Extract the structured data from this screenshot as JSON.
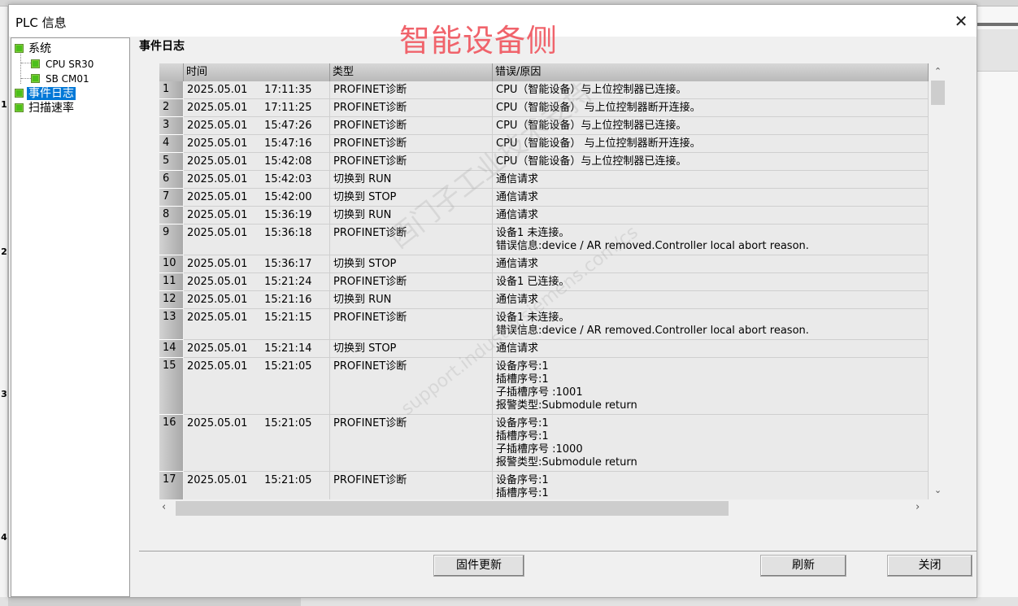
{
  "dialog": {
    "title": "PLC 信息",
    "overlay_label": "智能设备侧"
  },
  "bg": {
    "left_numbers": [
      "1",
      "2",
      "3",
      "4"
    ]
  },
  "tree": {
    "items": [
      {
        "label": "系统"
      },
      {
        "label": "CPU SR30"
      },
      {
        "label": "SB CM01"
      },
      {
        "label": "事件日志"
      },
      {
        "label": "扫描速率"
      }
    ]
  },
  "main": {
    "section_title": "事件日志",
    "columns": [
      "",
      "时间",
      "类型",
      "错误/原因"
    ],
    "rows": [
      {
        "num": "1",
        "time": "2025.05.01     17:11:35",
        "type": "PROFINET诊断",
        "reason": [
          "CPU（智能设备）与上位控制器已连接。"
        ]
      },
      {
        "num": "2",
        "time": "2025.05.01     17:11:25",
        "type": "PROFINET诊断",
        "reason": [
          "CPU（智能设备） 与上位控制器断开连接。"
        ]
      },
      {
        "num": "3",
        "time": "2025.05.01     15:47:26",
        "type": "PROFINET诊断",
        "reason": [
          "CPU（智能设备）与上位控制器已连接。"
        ]
      },
      {
        "num": "4",
        "time": "2025.05.01     15:47:16",
        "type": "PROFINET诊断",
        "reason": [
          "CPU（智能设备） 与上位控制器断开连接。"
        ]
      },
      {
        "num": "5",
        "time": "2025.05.01     15:42:08",
        "type": "PROFINET诊断",
        "reason": [
          "CPU（智能设备）与上位控制器已连接。"
        ]
      },
      {
        "num": "6",
        "time": "2025.05.01     15:42:03",
        "type": "切换到 RUN",
        "reason": [
          "通信请求"
        ]
      },
      {
        "num": "7",
        "time": "2025.05.01     15:42:00",
        "type": "切换到 STOP",
        "reason": [
          "通信请求"
        ]
      },
      {
        "num": "8",
        "time": "2025.05.01     15:36:19",
        "type": "切换到 RUN",
        "reason": [
          "通信请求"
        ]
      },
      {
        "num": "9",
        "time": "2025.05.01     15:36:18",
        "type": "PROFINET诊断",
        "reason": [
          "设备1 未连接。",
          "错误信息:device / AR removed.Controller local abort reason."
        ]
      },
      {
        "num": "10",
        "time": "2025.05.01     15:36:17",
        "type": "切换到 STOP",
        "reason": [
          "通信请求"
        ]
      },
      {
        "num": "11",
        "time": "2025.05.01     15:21:24",
        "type": "PROFINET诊断",
        "reason": [
          "设备1 已连接。"
        ]
      },
      {
        "num": "12",
        "time": "2025.05.01     15:21:16",
        "type": "切换到 RUN",
        "reason": [
          "通信请求"
        ]
      },
      {
        "num": "13",
        "time": "2025.05.01     15:21:15",
        "type": "PROFINET诊断",
        "reason": [
          "设备1 未连接。",
          "错误信息:device / AR removed.Controller local abort reason."
        ]
      },
      {
        "num": "14",
        "time": "2025.05.01     15:21:14",
        "type": "切换到 STOP",
        "reason": [
          "通信请求"
        ]
      },
      {
        "num": "15",
        "time": "2025.05.01     15:21:05",
        "type": "PROFINET诊断",
        "reason": [
          "设备序号:1",
          "插槽序号:1",
          "子插槽序号 :1001",
          "报警类型:Submodule return"
        ]
      },
      {
        "num": "16",
        "time": "2025.05.01     15:21:05",
        "type": "PROFINET诊断",
        "reason": [
          "设备序号:1",
          "插槽序号:1",
          "子插槽序号 :1000",
          "报警类型:Submodule return"
        ]
      },
      {
        "num": "17",
        "time": "2025.05.01     15:21:05",
        "type": "PROFINET诊断",
        "reason": [
          "设备序号:1",
          "插槽序号:1"
        ]
      }
    ]
  },
  "buttons": {
    "firmware_update": "固件更新",
    "refresh": "刷新",
    "close": "关闭"
  },
  "watermark": {
    "line1": "西门子工业技术支持",
    "line2": "support.industry.siemens.com/cs"
  }
}
